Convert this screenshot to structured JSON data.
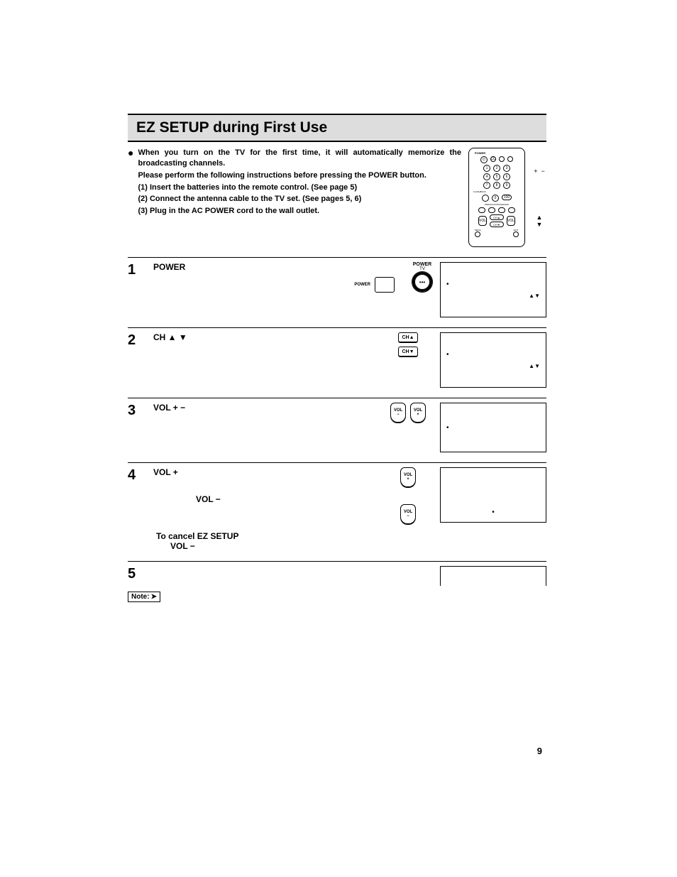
{
  "title": "EZ SETUP during First Use",
  "intro": {
    "main1": "When you turn on the TV for the first time, it will automatically memorize the broadcasting channels.",
    "main2": "Please perform the following instructions before pressing the POWER button.",
    "line1": "(1) Insert the batteries into the remote control. (See page 5)",
    "line2": "(2) Connect the antenna cable to the TV set.  (See pages 5, 6)",
    "line3": "(3) Plug in the AC POWER cord to the wall outlet."
  },
  "remote": {
    "topLabel": "POWER",
    "r1": [
      "CC",
      "DISPLAY",
      "INPUT"
    ],
    "numbers": [
      [
        "1",
        "2",
        "3"
      ],
      [
        "4",
        "5",
        "6"
      ],
      [
        "7",
        "8",
        "9"
      ],
      [
        "",
        "0",
        "100"
      ]
    ],
    "flash": "FLASHBACK",
    "mute": "MUTE",
    "prev": "PREVIOUS PROGRAMS",
    "ch": "CH",
    "vol": "VOL",
    "menu": "MENU",
    "exit": "EXIT"
  },
  "legend": {
    "plus": "+",
    "minus": "−",
    "up": "▲",
    "down": "▼"
  },
  "steps": {
    "s1": {
      "num": "1",
      "label": "POWER",
      "iconPowerLabel": "POWER",
      "iconPowerTv": "TV",
      "iconPowerSmall": "POWER",
      "box": {
        "dot": "•",
        "arrows": "▲▼"
      }
    },
    "s2": {
      "num": "2",
      "label": "CH ▲ ▼",
      "chUp": "CH▲",
      "chDown": "CH▼",
      "box": {
        "dot": "•",
        "arrows": "▲▼"
      }
    },
    "s3": {
      "num": "3",
      "label": "VOL  +  −",
      "volMinus": "VOL",
      "volMinusSign": "−",
      "volPlus": "VOL",
      "volPlusSign": "+",
      "box": {
        "dot": "•"
      }
    },
    "s4": {
      "num": "4",
      "labelA": "VOL  +",
      "labelB": "VOL  −",
      "volPlus": "VOL",
      "volPlusSign": "+",
      "volMinus": "VOL",
      "volMinusSign": "−",
      "box": {
        "dot": "•"
      },
      "cancelTitle": "To cancel EZ SETUP",
      "cancelLabel": "VOL  −"
    },
    "s5": {
      "num": "5"
    }
  },
  "note": "Note:",
  "pageNum": "9"
}
